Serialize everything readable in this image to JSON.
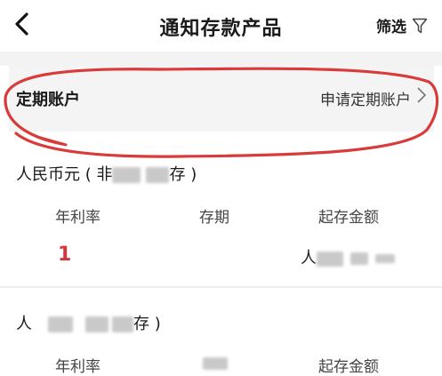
{
  "header": {
    "title": "通知存款产品",
    "filter_label": "筛选"
  },
  "fixed_account": {
    "label": "定期账户",
    "link": "申请定期账户"
  },
  "products": [
    {
      "title_prefix": "人民币元 ( 非",
      "title_suffix": "存 )",
      "columns": {
        "rate": "年利率",
        "term": "存期",
        "min_amount": "起存金额"
      },
      "rate_value": "1",
      "amount_prefix": "人"
    },
    {
      "title_prefix": "人",
      "title_suffix": "存 )",
      "columns": {
        "rate": "年利率",
        "min_amount": "起存金额"
      }
    }
  ],
  "colors": {
    "accent_red": "#d8353a",
    "annotation_red": "#d93b3b"
  }
}
